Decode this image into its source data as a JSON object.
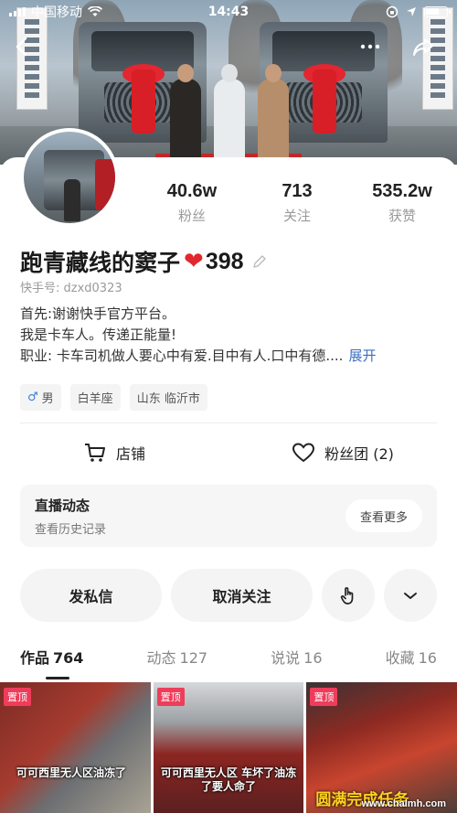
{
  "status_bar": {
    "carrier": "中国移动",
    "time": "14:43"
  },
  "banner": {
    "flag_left_text": "FOTON DAIMLER"
  },
  "stats": [
    {
      "value": "40.6w",
      "label": "粉丝"
    },
    {
      "value": "713",
      "label": "关注"
    },
    {
      "value": "535.2w",
      "label": "获赞"
    }
  ],
  "profile": {
    "name": "跑青藏线的窦子",
    "heart_count": "398",
    "uid": "快手号: dzxd0323",
    "bio": [
      "首先:谢谢快手官方平台。",
      "我是卡车人。传递正能量!",
      "职业: 卡车司机做人要心中有爱.目中有人.口中有德...."
    ],
    "expand_label": "展开"
  },
  "tags": [
    {
      "label": "男",
      "icon": "male-icon"
    },
    {
      "label": "白羊座"
    },
    {
      "label": "山东 临沂市"
    }
  ],
  "shop": {
    "shop_label": "店铺",
    "fans_label": "粉丝团 (2)"
  },
  "live": {
    "title": "直播动态",
    "subtitle": "查看历史记录",
    "more_label": "查看更多"
  },
  "actions": {
    "message_label": "发私信",
    "unfollow_label": "取消关注"
  },
  "tabs": [
    {
      "label": "作品",
      "count": "764",
      "active": true
    },
    {
      "label": "动态",
      "count": "127"
    },
    {
      "label": "说说",
      "count": "16"
    },
    {
      "label": "收藏",
      "count": "16"
    }
  ],
  "videos": [
    {
      "pin": "置顶",
      "caption": "可可西里无人区油冻了"
    },
    {
      "pin": "置顶",
      "caption": "可可西里无人区 车坏了油冻了要人命了"
    },
    {
      "pin": "置顶",
      "caption": "圆满完成任务"
    }
  ],
  "watermark": "www.chalmh.com"
}
